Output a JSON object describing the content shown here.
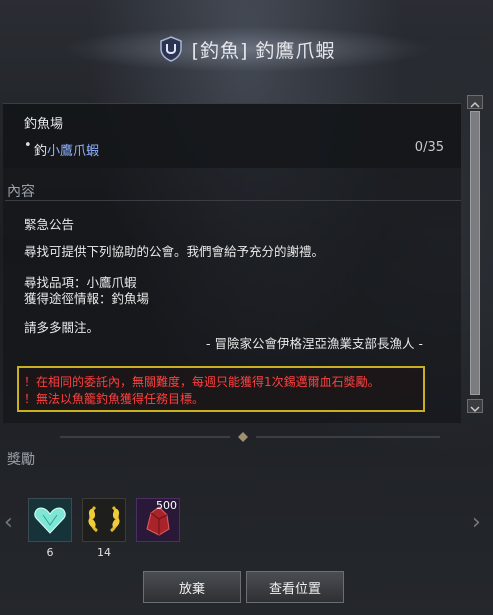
{
  "header": {
    "title": "[釣魚] 釣鷹爪蝦"
  },
  "objective_section": {
    "location_label": "釣魚場",
    "objective_prefix": "釣",
    "objective_highlight": "小鷹爪蝦",
    "progress": "0/35"
  },
  "content_section": {
    "label": "內容",
    "notice_title": "緊急公告",
    "request_line": "尋找可提供下列協助的公會。我們會給予充分的謝禮。",
    "item_line": "尋找品項：小鷹爪蝦",
    "route_line": "獲得途徑情報：釣魚場",
    "closing_line": "請多多關注。",
    "signature": "- 冒險家公會伊格涅亞漁業支部長漁人 -",
    "warnings": [
      "！在相同的委託內，無關難度，每週只能獲得1次錫邁爾血石獎勵。",
      "！無法以魚籠釣魚獲得任務目標。"
    ]
  },
  "rewards_section": {
    "label": "獎勵",
    "items": [
      {
        "icon": "diamond-heart-icon",
        "count": "6",
        "badge": ""
      },
      {
        "icon": "laurel-wreath-icon",
        "count": "14",
        "badge": ""
      },
      {
        "icon": "bloodstone-icon",
        "count": "",
        "badge": "500"
      }
    ]
  },
  "buttons": {
    "abandon": "放棄",
    "view_location": "查看位置"
  },
  "colors": {
    "highlight_blue": "#8fb3ff",
    "warning_red": "#ff4040",
    "warning_border": "#c8b020"
  }
}
